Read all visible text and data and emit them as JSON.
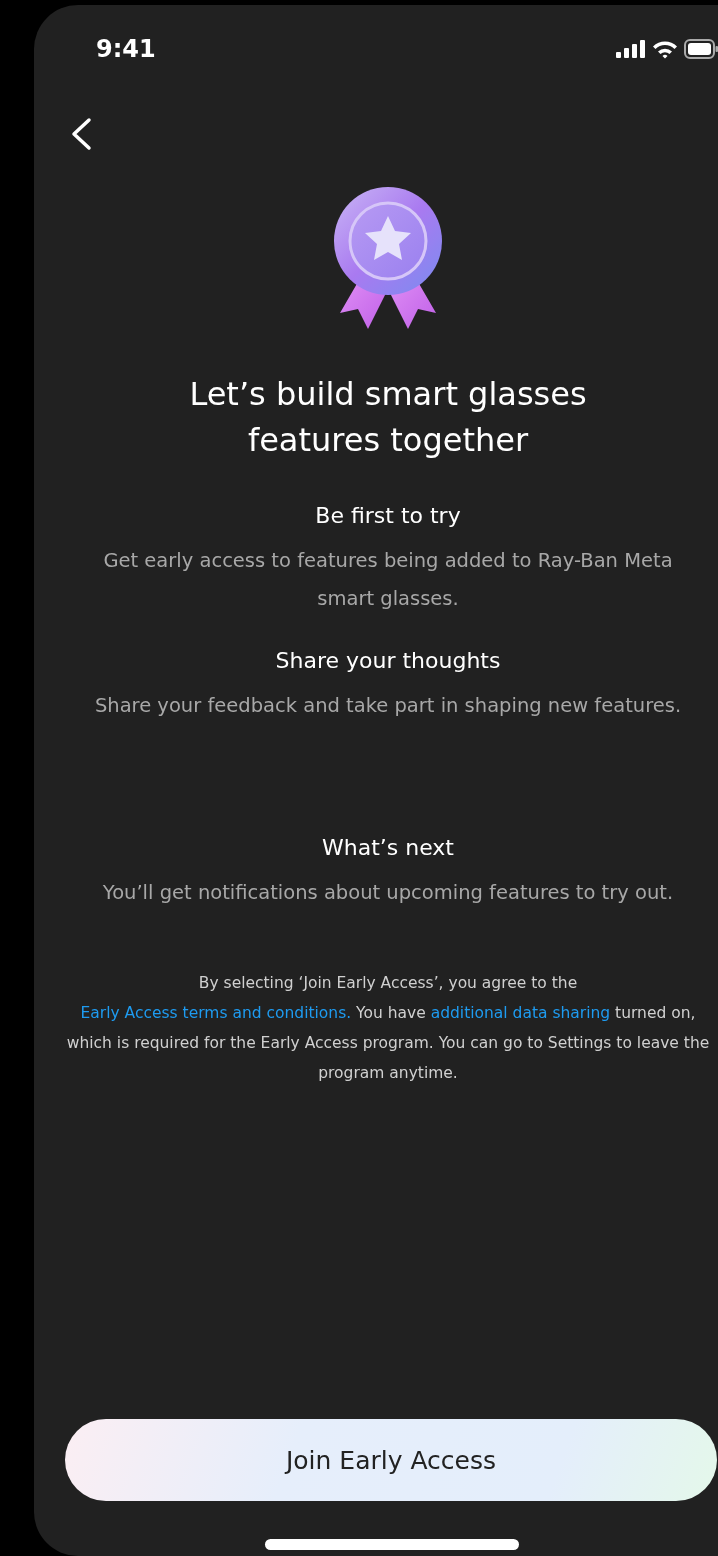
{
  "status_bar": {
    "time": "9:41"
  },
  "title": "Let’s build smart glasses features together",
  "sections": [
    {
      "heading": "Be first to try",
      "text": "Get early access to features being added to Ray-Ban Meta smart glasses."
    },
    {
      "heading": "Share your thoughts",
      "text": "Share your feedback and take part in shaping new features."
    },
    {
      "heading": "What’s next",
      "text": "You’ll get notifications about upcoming features to try out."
    }
  ],
  "legal": [
    {
      "kind": "text",
      "text": "By selecting ‘Join Early Access’, you agree to the "
    },
    {
      "kind": "link",
      "text": "Early Access terms and conditions."
    },
    {
      "kind": "text",
      "text": " You have "
    },
    {
      "kind": "link",
      "text": "additional data sharing"
    },
    {
      "kind": "text",
      "text": " turned on, which is required for the Early Access program. You can go to Settings to leave the program anytime."
    }
  ],
  "button": {
    "label": "Join Early Access"
  }
}
